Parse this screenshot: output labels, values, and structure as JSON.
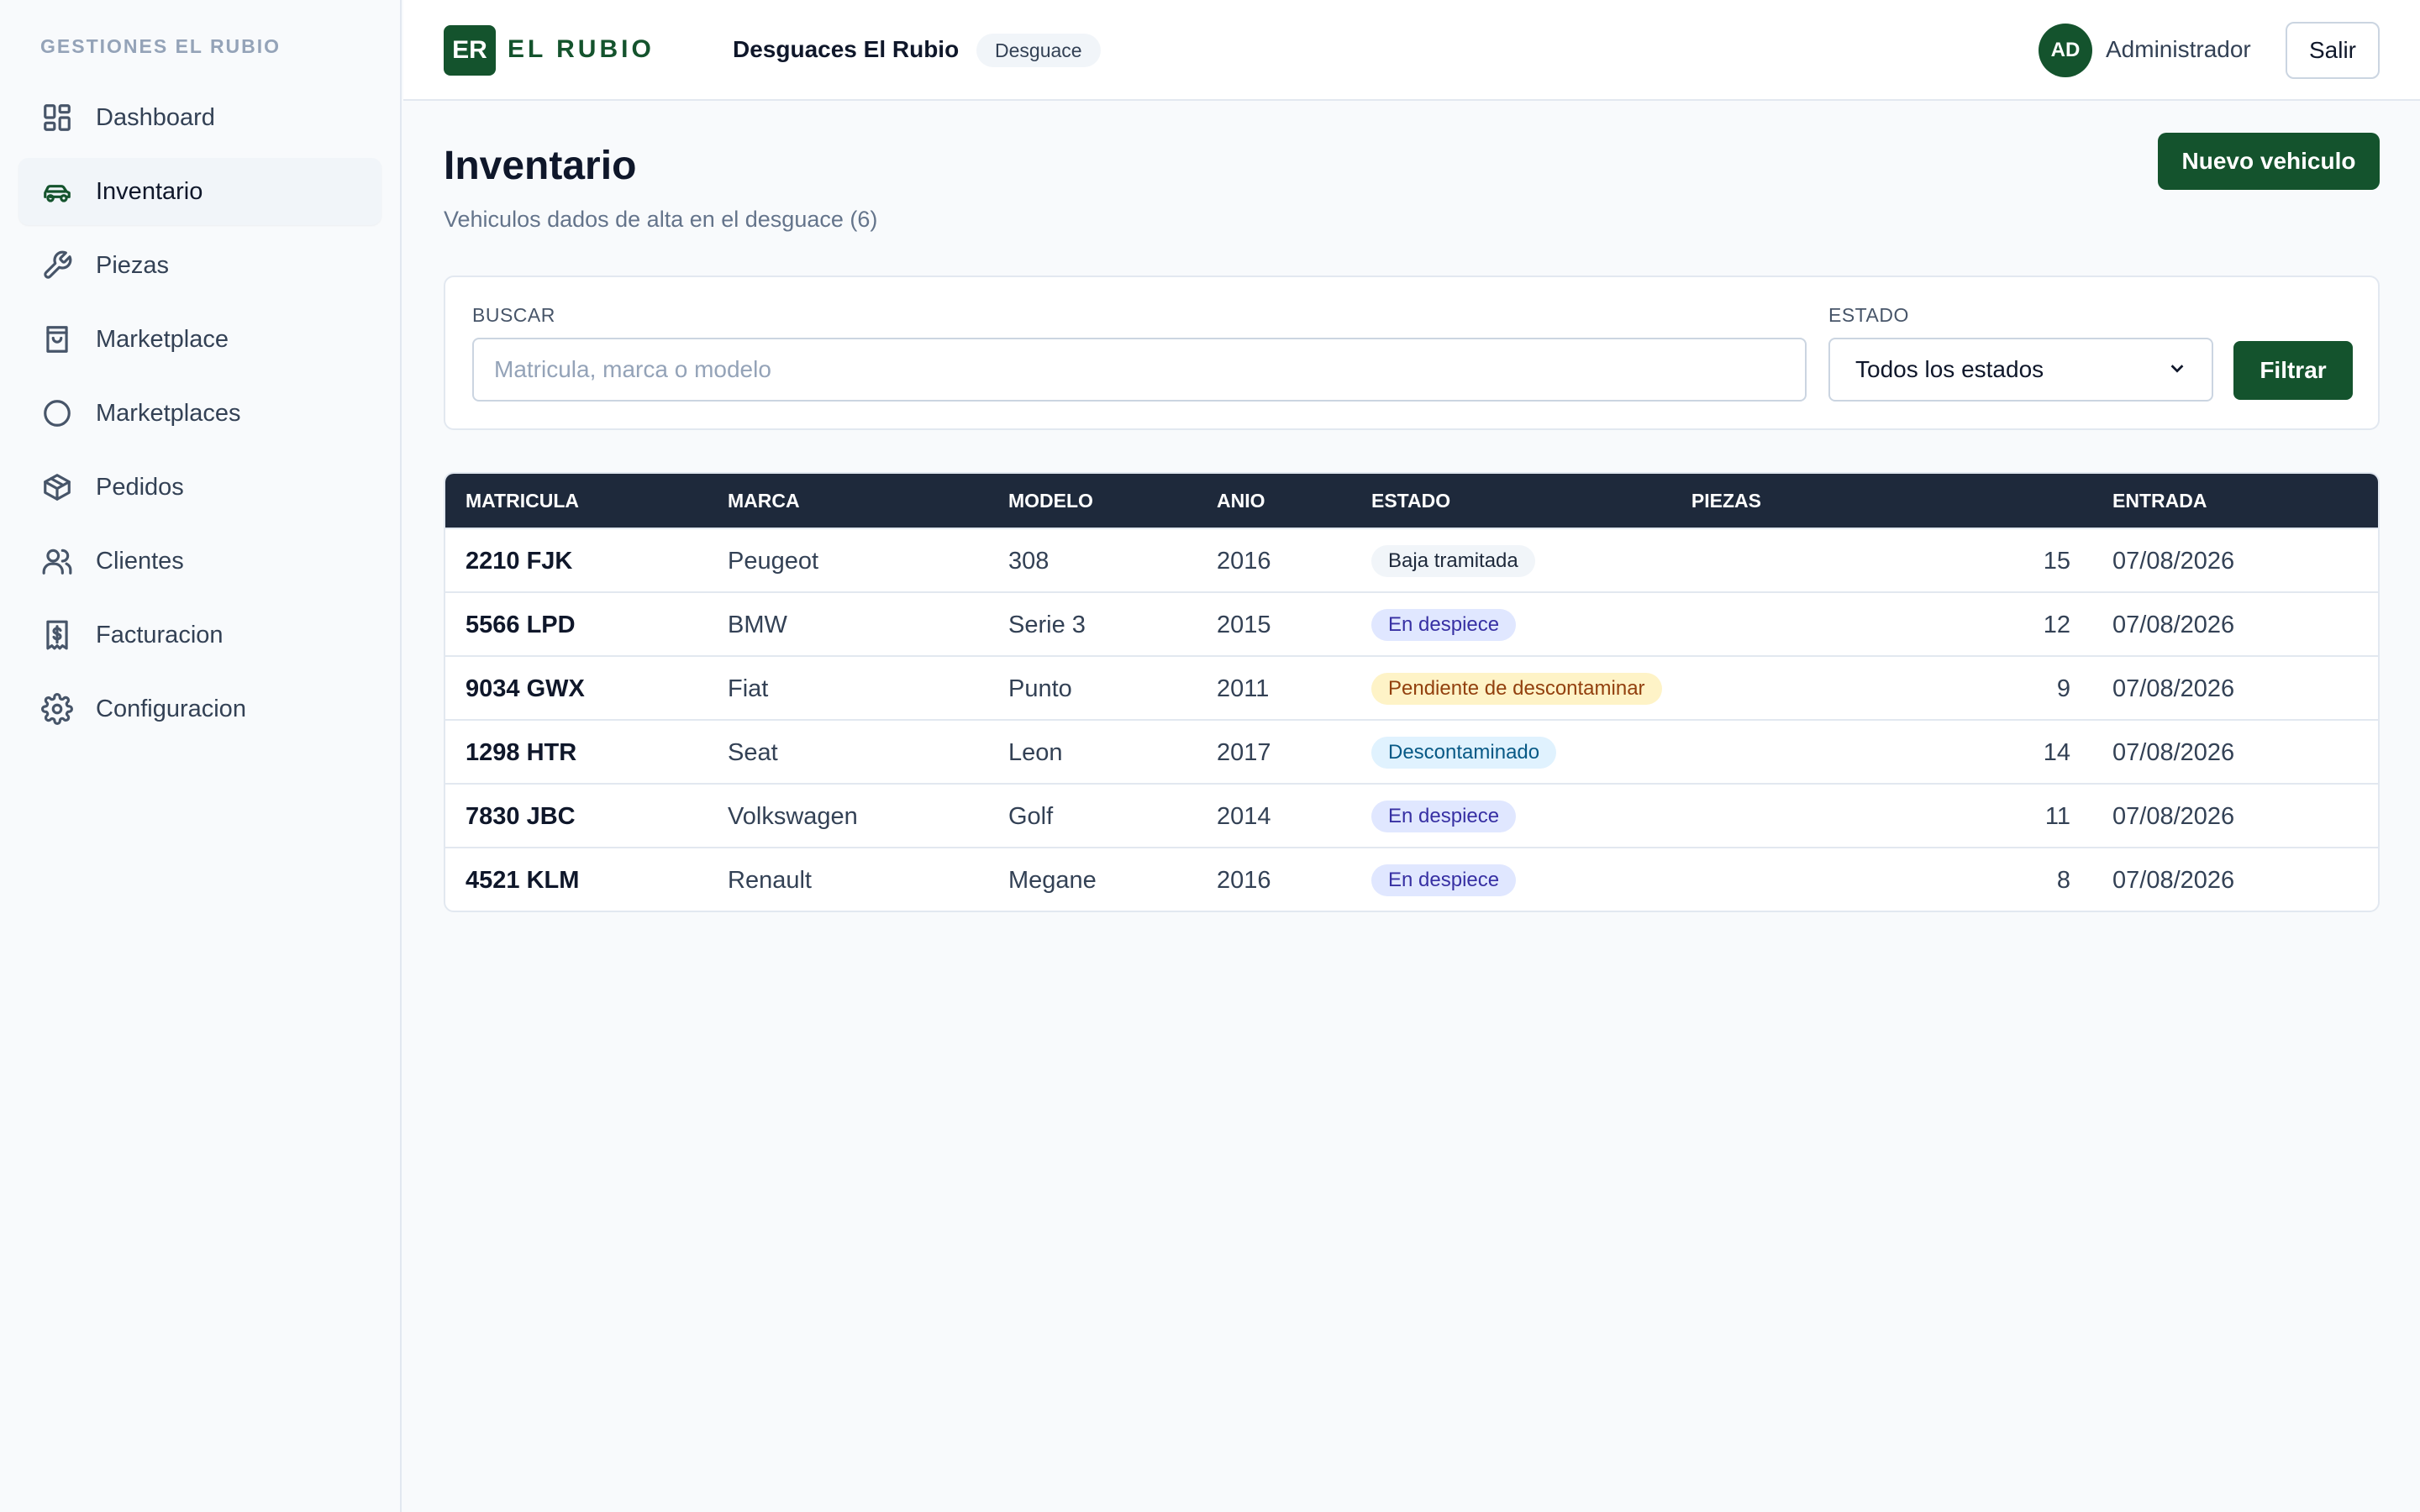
{
  "sidebar": {
    "caption": "GESTIONES EL RUBIO",
    "items": [
      {
        "label": "Dashboard",
        "icon": "dashboard-icon",
        "active": false
      },
      {
        "label": "Inventario",
        "icon": "car-icon",
        "active": true
      },
      {
        "label": "Piezas",
        "icon": "wrench-icon",
        "active": false
      },
      {
        "label": "Marketplace",
        "icon": "shopping-bag-icon",
        "active": false
      },
      {
        "label": "Marketplaces",
        "icon": "circle-icon",
        "active": false
      },
      {
        "label": "Pedidos",
        "icon": "box-icon",
        "active": false
      },
      {
        "label": "Clientes",
        "icon": "users-icon",
        "active": false
      },
      {
        "label": "Facturacion",
        "icon": "invoice-icon",
        "active": false
      },
      {
        "label": "Configuracion",
        "icon": "gear-icon",
        "active": false
      }
    ]
  },
  "header": {
    "logo_initials": "ER",
    "logo_text": "EL RUBIO",
    "company_name": "Desguaces El Rubio",
    "company_tag": "Desguace",
    "user_initials": "AD",
    "user_name": "Administrador",
    "logout_label": "Salir"
  },
  "main": {
    "title": "Inventario",
    "subtitle": "Vehiculos dados de alta en el desguace (6)",
    "new_button": "Nuevo vehiculo",
    "filters": {
      "search_label": "BUSCAR",
      "search_placeholder": "Matricula, marca o modelo",
      "search_value": "",
      "status_label": "ESTADO",
      "status_value": "Todos los estados",
      "filter_button": "Filtrar"
    },
    "table": {
      "columns": [
        "MATRICULA",
        "MARCA",
        "MODELO",
        "ANIO",
        "ESTADO",
        "PIEZAS",
        "ENTRADA"
      ],
      "rows": [
        {
          "plate": "2210 FJK",
          "brand": "Peugeot",
          "model": "308",
          "year": "2016",
          "status": "Baja tramitada",
          "status_kind": "gray",
          "parts": "15",
          "entry": "07/08/2026"
        },
        {
          "plate": "5566 LPD",
          "brand": "BMW",
          "model": "Serie 3",
          "year": "2015",
          "status": "En despiece",
          "status_kind": "indigo",
          "parts": "12",
          "entry": "07/08/2026"
        },
        {
          "plate": "9034 GWX",
          "brand": "Fiat",
          "model": "Punto",
          "year": "2011",
          "status": "Pendiente de descontaminar",
          "status_kind": "amber",
          "parts": "9",
          "entry": "07/08/2026"
        },
        {
          "plate": "1298 HTR",
          "brand": "Seat",
          "model": "Leon",
          "year": "2017",
          "status": "Descontaminado",
          "status_kind": "cyan",
          "parts": "14",
          "entry": "07/08/2026"
        },
        {
          "plate": "7830 JBC",
          "brand": "Volkswagen",
          "model": "Golf",
          "year": "2014",
          "status": "En despiece",
          "status_kind": "indigo",
          "parts": "11",
          "entry": "07/08/2026"
        },
        {
          "plate": "4521 KLM",
          "brand": "Renault",
          "model": "Megane",
          "year": "2016",
          "status": "En despiece",
          "status_kind": "indigo",
          "parts": "8",
          "entry": "07/08/2026"
        }
      ]
    }
  },
  "colors": {
    "brand": "#14532d",
    "table_header": "#1e293b",
    "badge_gray_bg": "#f1f5f9",
    "badge_gray_fg": "#1e293b",
    "badge_indigo_bg": "#e0e7ff",
    "badge_indigo_fg": "#3730a3",
    "badge_amber_bg": "#fef3c7",
    "badge_amber_fg": "#92400e",
    "badge_cyan_bg": "#e0f2fe",
    "badge_cyan_fg": "#075985"
  }
}
